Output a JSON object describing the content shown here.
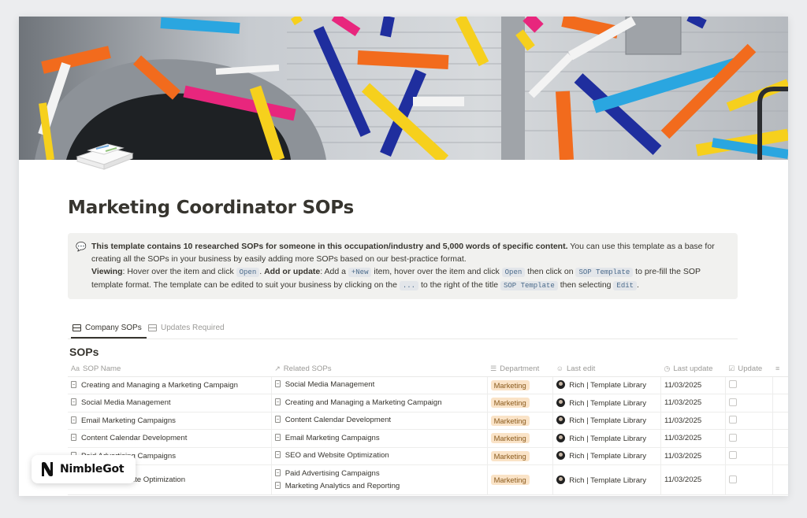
{
  "page": {
    "title": "Marketing Coordinator SOPs"
  },
  "callout": {
    "icon": "speech-bubble-icon",
    "intro_bold": "This template contains 10 researched SOPs for someone in this occupation/industry and 5,000 words of specific content.",
    "intro_rest": " You can use this template as a base for creating all the SOPs in your business by easily adding more SOPs based on our best-practice format.",
    "viewing_label": "Viewing",
    "viewing_text": ": Hover over the item and click ",
    "open_code": "Open",
    "add_label": "Add or update",
    "add_text": ": Add a ",
    "new_code": "+New",
    "add_text2": " item, hover over the item and click ",
    "open_code2": "Open",
    "then_click": " then click on ",
    "sop_template_code": "SOP Template",
    "prefill_text": " to pre-fill the SOP template format. The template can be edited to suit your business by clicking on the ",
    "dots_code": "...",
    "right_of_title": " to the right of the title ",
    "sop_template_code2": "SOP Template",
    "then_selecting": " then selecting ",
    "edit_code": "Edit",
    "period": "."
  },
  "tabs": [
    {
      "label": "Company SOPs",
      "active": true
    },
    {
      "label": "Updates Required",
      "active": false
    }
  ],
  "database": {
    "title": "SOPs",
    "columns": {
      "name": "SOP Name",
      "related": "Related SOPs",
      "department": "Department",
      "last_edit": "Last edit",
      "last_update": "Last update",
      "update": "Update"
    },
    "column_icons": {
      "name": "Aa",
      "related": "↗",
      "department": "☰",
      "last_edit": "☺",
      "last_update": "◷",
      "update": "☑"
    },
    "rows": [
      {
        "name": "Creating and Managing a Marketing Campaign",
        "related": [
          "Social Media Management"
        ],
        "department": "Marketing",
        "editor": "Rich | Template Library",
        "date": "11/03/2025"
      },
      {
        "name": "Social Media Management",
        "related": [
          "Creating and Managing a Marketing Campaign"
        ],
        "department": "Marketing",
        "editor": "Rich | Template Library",
        "date": "11/03/2025"
      },
      {
        "name": "Email Marketing Campaigns",
        "related": [
          "Content Calendar Development"
        ],
        "department": "Marketing",
        "editor": "Rich | Template Library",
        "date": "11/03/2025"
      },
      {
        "name": "Content Calendar Development",
        "related": [
          "Email Marketing Campaigns"
        ],
        "department": "Marketing",
        "editor": "Rich | Template Library",
        "date": "11/03/2025"
      },
      {
        "name": "Paid Advertising Campaigns",
        "related": [
          "SEO and Website Optimization"
        ],
        "department": "Marketing",
        "editor": "Rich | Template Library",
        "date": "11/03/2025"
      },
      {
        "name": "SEO and Website Optimization",
        "related": [
          "Paid Advertising Campaigns",
          "Marketing Analytics and Reporting"
        ],
        "department": "Marketing",
        "editor": "Rich | Template Library",
        "date": "11/03/2025"
      }
    ]
  },
  "branding": {
    "name": "NimbleGot",
    "logo_icon": "nimblegot-n-logo"
  },
  "colors": {
    "tag_bg": "#fae3c7",
    "tag_text": "#8a5a1c",
    "callout_bg": "#f1f1ef"
  }
}
